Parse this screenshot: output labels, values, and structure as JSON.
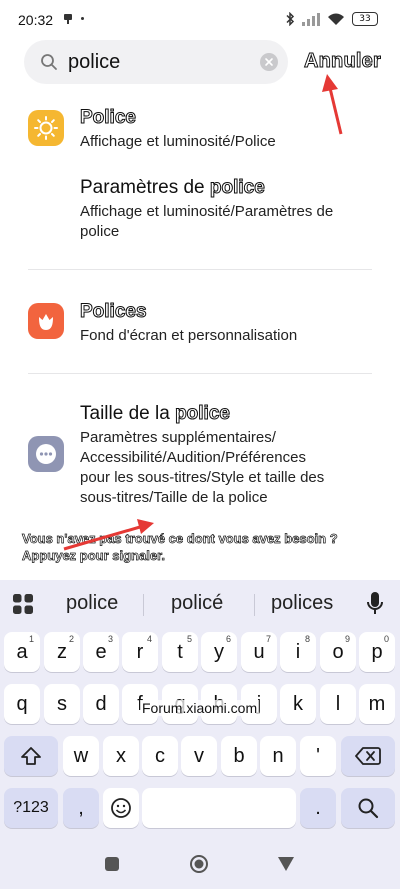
{
  "status_bar": {
    "time": "20:32",
    "battery": "33",
    "icons": [
      "usb-debug-icon",
      "bluetooth-icon",
      "signal-icon",
      "wifi-icon",
      "battery-icon"
    ]
  },
  "search": {
    "value": "police",
    "clear_icon": "clear-icon",
    "cancel_label": "Annuler"
  },
  "results": [
    {
      "title_before": "",
      "title_match": "Police",
      "subtitle": "Affichage et luminosité/Police",
      "icon": "brightness-icon",
      "icon_color": "#f5b731"
    },
    {
      "title_before": "Paramètres de ",
      "title_match": "police",
      "subtitle_lines": [
        "Affichage et luminosité/Paramètres de",
        "police"
      ]
    },
    {
      "title_before": "",
      "title_match": "Polices",
      "subtitle": "Fond d'écran et personnalisation",
      "icon": "tulip-icon",
      "icon_color": "#f2643e"
    },
    {
      "title_before": "Taille de la ",
      "title_match": "police",
      "subtitle_lines": [
        "Paramètres supplémentaires/",
        "Accessibilité/Audition/Préférences",
        "pour les sous-titres/Style et taille des",
        "sous-titres/Taille de la police"
      ],
      "icon": "more-icon",
      "icon_color": "#8f95b3"
    }
  ],
  "report": {
    "line1": "Vous n'avez pas trouvé ce dont vous avez besoin ?",
    "line2": "Appuyez pour signaler."
  },
  "keyboard": {
    "suggestions": [
      "police",
      "policé",
      "polices"
    ],
    "row1": [
      {
        "k": "a",
        "h": "1"
      },
      {
        "k": "z",
        "h": "2"
      },
      {
        "k": "e",
        "h": "3"
      },
      {
        "k": "r",
        "h": "4"
      },
      {
        "k": "t",
        "h": "5"
      },
      {
        "k": "y",
        "h": "6"
      },
      {
        "k": "u",
        "h": "7"
      },
      {
        "k": "i",
        "h": "8"
      },
      {
        "k": "o",
        "h": "9"
      },
      {
        "k": "p",
        "h": "0"
      }
    ],
    "row2": [
      "q",
      "s",
      "d",
      "f",
      "g",
      "h",
      "j",
      "k",
      "l",
      "m"
    ],
    "row3": [
      "w",
      "x",
      "c",
      "v",
      "b",
      "n",
      "'"
    ],
    "symbols_label": "?123",
    "comma": ",",
    "period": ".",
    "emoji_icon": "emoji-icon",
    "search_icon": "search-icon"
  },
  "watermark": "Forum.xiaomi.com",
  "colors": {
    "accent": "#4a5bd6",
    "keyboard_bg": "#ececf7",
    "arrow": "#e53935"
  }
}
